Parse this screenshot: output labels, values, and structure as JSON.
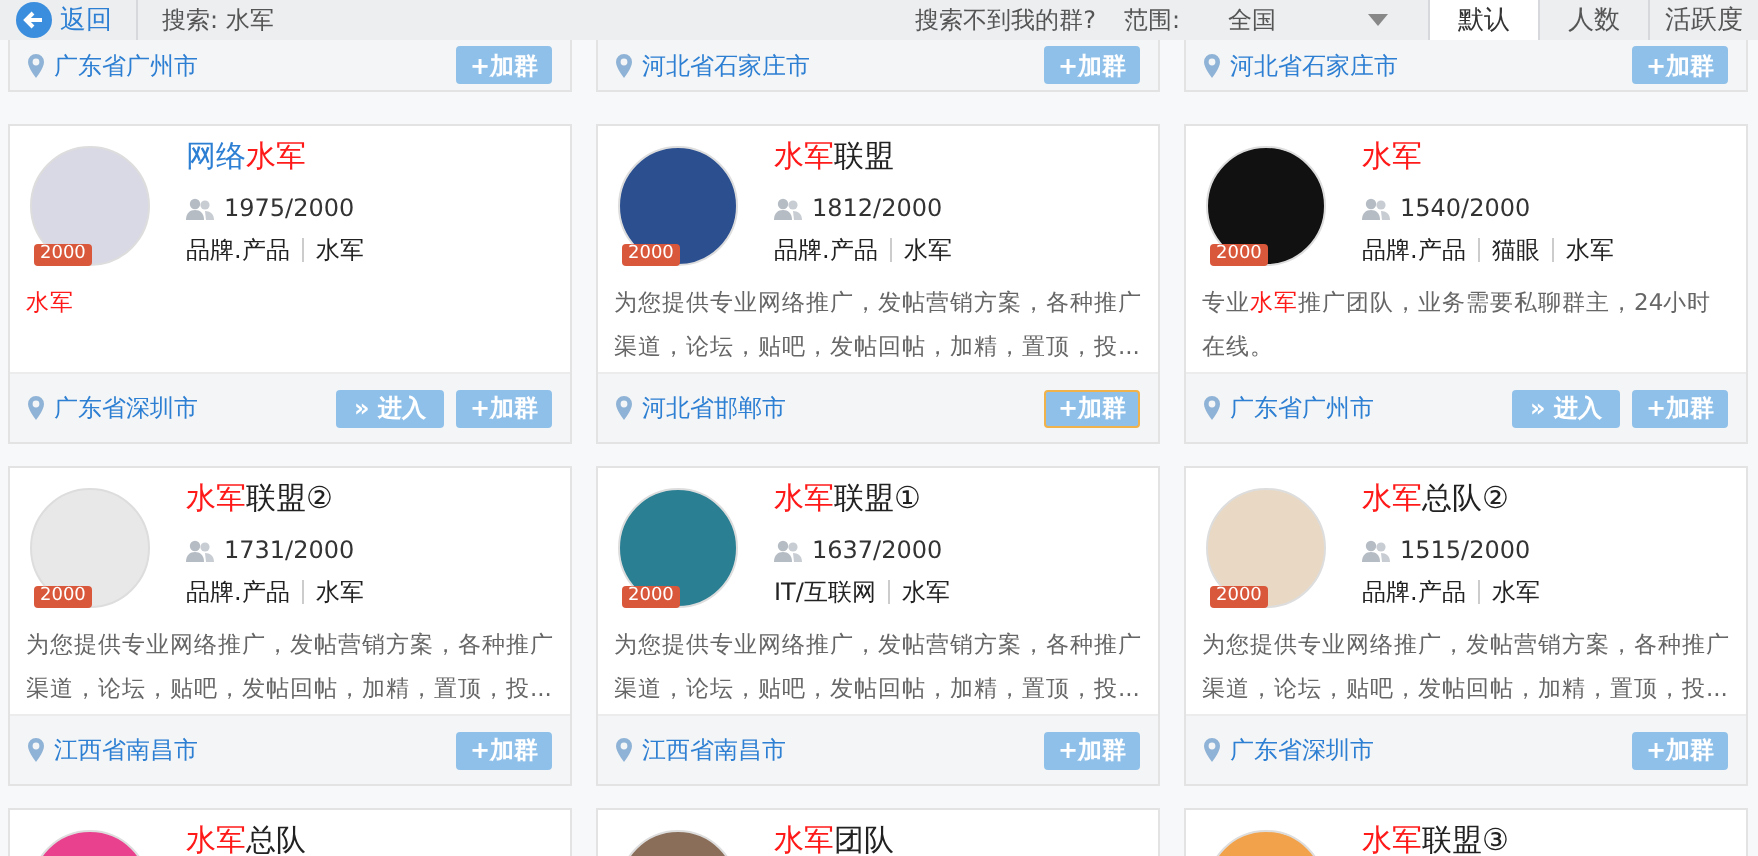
{
  "toolbar": {
    "back": "返回",
    "search_label": "搜索: 水军",
    "not_found": "搜索不到我的群?",
    "scope_label": "范围:",
    "scope_value": "全国",
    "sort_tabs": [
      {
        "label": "默认",
        "selected": true
      },
      {
        "label": "人数",
        "selected": false
      },
      {
        "label": "活跃度",
        "selected": false
      }
    ]
  },
  "top_row": [
    {
      "location": "广东省广州市",
      "join": "+加群"
    },
    {
      "location": "河北省石家庄市",
      "join": "+加群"
    },
    {
      "location": "河北省石家庄市",
      "join": "+加群"
    }
  ],
  "groups": [
    {
      "title": [
        {
          "text": "网络",
          "highlight": false
        },
        {
          "text": "水军",
          "highlight": true
        }
      ],
      "badge": "2000",
      "members": "1975/2000",
      "tags": [
        "品牌.产品",
        "水军"
      ],
      "description": [
        {
          "text": "水军",
          "highlight": true
        }
      ],
      "location": "广东省深圳市",
      "enter": "» 进入",
      "join": "+加群",
      "focused": false
    },
    {
      "title": [
        {
          "text": "水军",
          "highlight": true
        },
        {
          "text": "联盟",
          "highlight": false
        }
      ],
      "badge": "2000",
      "members": "1812/2000",
      "tags": [
        "品牌.产品",
        "水军"
      ],
      "description": [
        {
          "text": "为您提供专业网络推广，发帖营销方案，各种推广渠道，论坛，贴吧，发帖回帖，加精，置顶，投...",
          "highlight": false
        }
      ],
      "location": "河北省邯郸市",
      "join": "+加群",
      "focused": true
    },
    {
      "title": [
        {
          "text": "水军",
          "highlight": true
        }
      ],
      "badge": "2000",
      "members": "1540/2000",
      "tags": [
        "品牌.产品",
        "猫眼",
        "水军"
      ],
      "description": [
        {
          "text": "专业",
          "highlight": false
        },
        {
          "text": "水军",
          "highlight": true
        },
        {
          "text": "推广团队，业务需要私聊群主，24小时在线。",
          "highlight": false
        }
      ],
      "location": "广东省广州市",
      "enter": "» 进入",
      "join": "+加群",
      "focused": false
    },
    {
      "title": [
        {
          "text": "水军",
          "highlight": true
        },
        {
          "text": "联盟②",
          "highlight": false
        }
      ],
      "badge": "2000",
      "members": "1731/2000",
      "tags": [
        "品牌.产品",
        "水军"
      ],
      "description": [
        {
          "text": "为您提供专业网络推广，发帖营销方案，各种推广渠道，论坛，贴吧，发帖回帖，加精，置顶，投...",
          "highlight": false
        }
      ],
      "location": "江西省南昌市",
      "join": "+加群",
      "focused": false
    },
    {
      "title": [
        {
          "text": "水军",
          "highlight": true
        },
        {
          "text": "联盟①",
          "highlight": false
        }
      ],
      "badge": "2000",
      "members": "1637/2000",
      "tags": [
        "IT/互联网",
        "水军"
      ],
      "description": [
        {
          "text": "为您提供专业网络推广，发帖营销方案，各种推广渠道，论坛，贴吧，发帖回帖，加精，置顶，投...",
          "highlight": false
        }
      ],
      "location": "江西省南昌市",
      "join": "+加群",
      "focused": false
    },
    {
      "title": [
        {
          "text": "水军",
          "highlight": true
        },
        {
          "text": "总队②",
          "highlight": false
        }
      ],
      "badge": "2000",
      "members": "1515/2000",
      "tags": [
        "品牌.产品",
        "水军"
      ],
      "description": [
        {
          "text": "为您提供专业网络推广，发帖营销方案，各种推广渠道，论坛，贴吧，发帖回帖，加精，置顶，投...",
          "highlight": false
        }
      ],
      "location": "广东省深圳市",
      "join": "+加群",
      "focused": false
    },
    {
      "title": [
        {
          "text": "水军",
          "highlight": true
        },
        {
          "text": "总队",
          "highlight": false
        }
      ]
    },
    {
      "title": [
        {
          "text": "水军",
          "highlight": true
        },
        {
          "text": "团队",
          "highlight": false
        }
      ]
    },
    {
      "title": [
        {
          "text": "水军",
          "highlight": true
        },
        {
          "text": "联盟③",
          "highlight": false
        }
      ]
    }
  ]
}
